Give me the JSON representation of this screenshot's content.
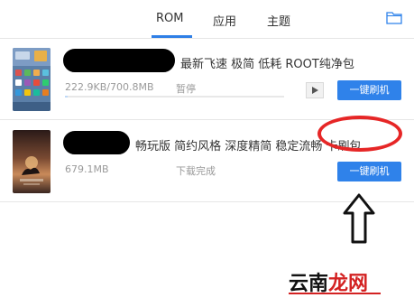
{
  "tabs": {
    "rom": "ROM",
    "apps": "应用",
    "themes": "主题"
  },
  "icons": {
    "folder": "folder-icon",
    "play": "play-icon",
    "arrow": "up-arrow-icon"
  },
  "colors": {
    "accent": "#2f82ea",
    "annotation_red": "#e62626"
  },
  "roms": [
    {
      "title_suffix": "最新飞速 极简 低耗 ROOT纯净包",
      "size": "222.9KB/700.8MB",
      "status": "暂停",
      "action": "一键刷机",
      "progress_fraction": 0.0003
    },
    {
      "title_suffix": "畅玩版  简约风格 深度精简 稳定流畅 卡刷包",
      "size": "679.1MB",
      "status": "下载完成",
      "action": "一键刷机"
    }
  ],
  "watermark": {
    "part1": "云南",
    "part2": "龙网"
  }
}
